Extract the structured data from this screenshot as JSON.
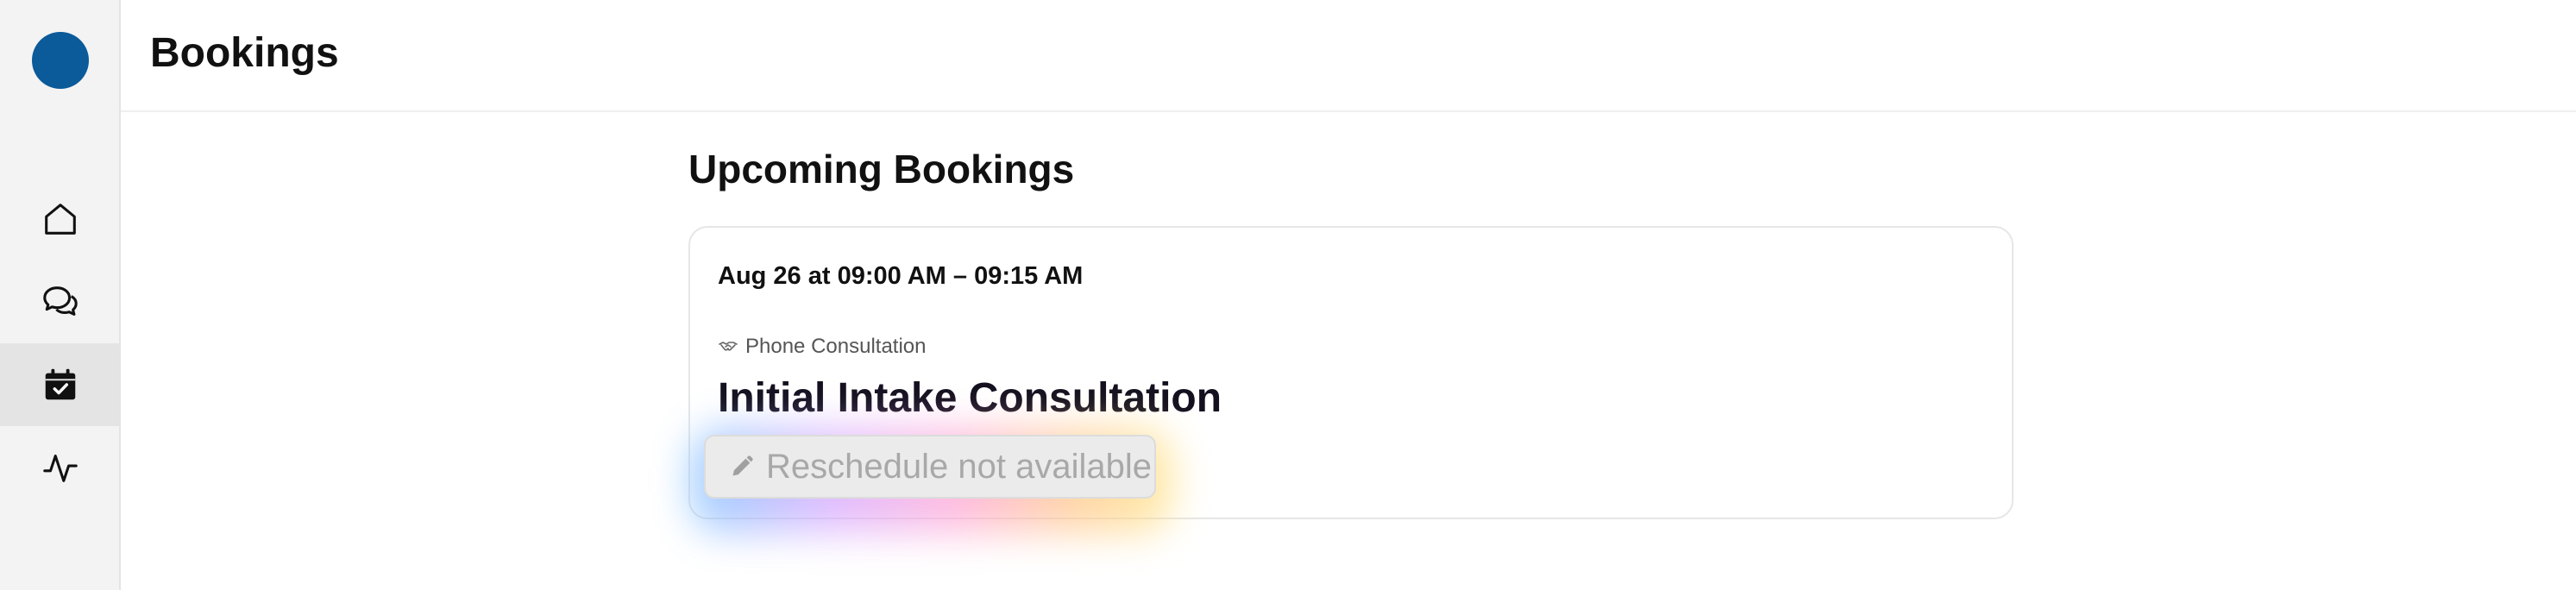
{
  "colors": {
    "avatar": "#0b5a9a",
    "sidebar_bg": "#f3f3f3",
    "active_nav_bg": "#e4e4e4",
    "disabled_text": "#a8a8a8"
  },
  "sidebar": {
    "items": [
      {
        "name": "home",
        "icon": "home-icon",
        "active": false
      },
      {
        "name": "messages",
        "icon": "chat-bubbles-icon",
        "active": false
      },
      {
        "name": "bookings",
        "icon": "calendar-check-icon",
        "active": true
      },
      {
        "name": "activity",
        "icon": "activity-pulse-icon",
        "active": false
      }
    ]
  },
  "header": {
    "title": "Bookings"
  },
  "main": {
    "section_title": "Upcoming Bookings",
    "booking": {
      "time": "Aug 26 at 09:00 AM – 09:15 AM",
      "type_icon": "handshake-icon",
      "type": "Phone Consultation",
      "title": "Initial Intake Consultation",
      "action_icon": "pencil-icon",
      "action_label": "Reschedule not available",
      "action_disabled": true
    }
  }
}
